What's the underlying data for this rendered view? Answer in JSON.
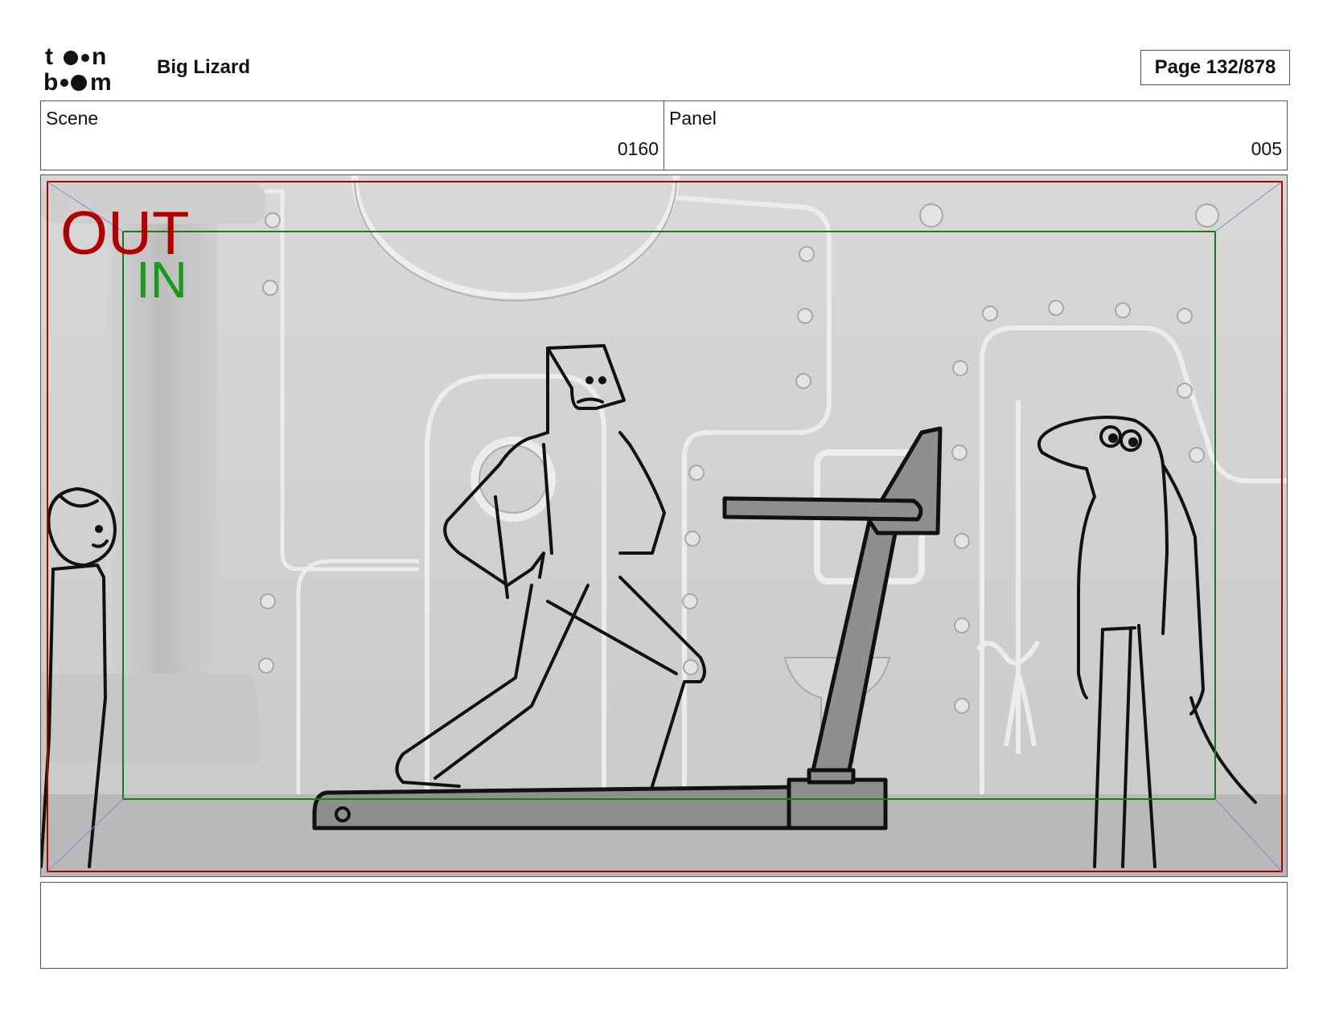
{
  "header": {
    "logo_text_top": "toon",
    "logo_text_bottom": "boom",
    "project_title": "Big Lizard",
    "page_label": "Page 132/878"
  },
  "info": {
    "scene_label": "Scene",
    "scene_value": "0160",
    "panel_label": "Panel",
    "panel_value": "005"
  },
  "frame": {
    "out_label": "OUT",
    "in_label": "IN",
    "out_color": "#b00000",
    "in_color": "#1a9a1a"
  },
  "notes": {
    "text": ""
  }
}
